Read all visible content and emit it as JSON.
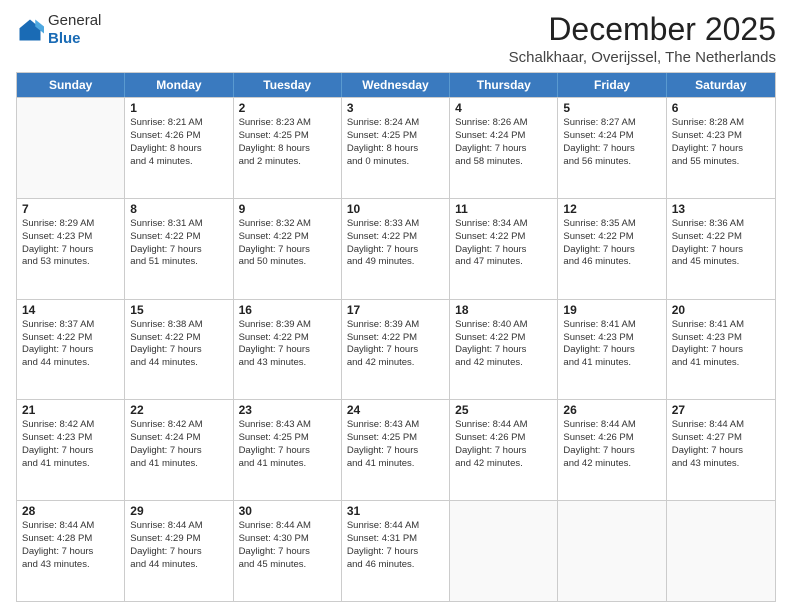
{
  "logo": {
    "general": "General",
    "blue": "Blue"
  },
  "title": "December 2025",
  "subtitle": "Schalkhaar, Overijssel, The Netherlands",
  "calendar": {
    "headers": [
      "Sunday",
      "Monday",
      "Tuesday",
      "Wednesday",
      "Thursday",
      "Friday",
      "Saturday"
    ],
    "weeks": [
      [
        {
          "date": "",
          "info": ""
        },
        {
          "date": "1",
          "info": "Sunrise: 8:21 AM\nSunset: 4:26 PM\nDaylight: 8 hours\nand 4 minutes."
        },
        {
          "date": "2",
          "info": "Sunrise: 8:23 AM\nSunset: 4:25 PM\nDaylight: 8 hours\nand 2 minutes."
        },
        {
          "date": "3",
          "info": "Sunrise: 8:24 AM\nSunset: 4:25 PM\nDaylight: 8 hours\nand 0 minutes."
        },
        {
          "date": "4",
          "info": "Sunrise: 8:26 AM\nSunset: 4:24 PM\nDaylight: 7 hours\nand 58 minutes."
        },
        {
          "date": "5",
          "info": "Sunrise: 8:27 AM\nSunset: 4:24 PM\nDaylight: 7 hours\nand 56 minutes."
        },
        {
          "date": "6",
          "info": "Sunrise: 8:28 AM\nSunset: 4:23 PM\nDaylight: 7 hours\nand 55 minutes."
        }
      ],
      [
        {
          "date": "7",
          "info": "Sunrise: 8:29 AM\nSunset: 4:23 PM\nDaylight: 7 hours\nand 53 minutes."
        },
        {
          "date": "8",
          "info": "Sunrise: 8:31 AM\nSunset: 4:22 PM\nDaylight: 7 hours\nand 51 minutes."
        },
        {
          "date": "9",
          "info": "Sunrise: 8:32 AM\nSunset: 4:22 PM\nDaylight: 7 hours\nand 50 minutes."
        },
        {
          "date": "10",
          "info": "Sunrise: 8:33 AM\nSunset: 4:22 PM\nDaylight: 7 hours\nand 49 minutes."
        },
        {
          "date": "11",
          "info": "Sunrise: 8:34 AM\nSunset: 4:22 PM\nDaylight: 7 hours\nand 47 minutes."
        },
        {
          "date": "12",
          "info": "Sunrise: 8:35 AM\nSunset: 4:22 PM\nDaylight: 7 hours\nand 46 minutes."
        },
        {
          "date": "13",
          "info": "Sunrise: 8:36 AM\nSunset: 4:22 PM\nDaylight: 7 hours\nand 45 minutes."
        }
      ],
      [
        {
          "date": "14",
          "info": "Sunrise: 8:37 AM\nSunset: 4:22 PM\nDaylight: 7 hours\nand 44 minutes."
        },
        {
          "date": "15",
          "info": "Sunrise: 8:38 AM\nSunset: 4:22 PM\nDaylight: 7 hours\nand 44 minutes."
        },
        {
          "date": "16",
          "info": "Sunrise: 8:39 AM\nSunset: 4:22 PM\nDaylight: 7 hours\nand 43 minutes."
        },
        {
          "date": "17",
          "info": "Sunrise: 8:39 AM\nSunset: 4:22 PM\nDaylight: 7 hours\nand 42 minutes."
        },
        {
          "date": "18",
          "info": "Sunrise: 8:40 AM\nSunset: 4:22 PM\nDaylight: 7 hours\nand 42 minutes."
        },
        {
          "date": "19",
          "info": "Sunrise: 8:41 AM\nSunset: 4:23 PM\nDaylight: 7 hours\nand 41 minutes."
        },
        {
          "date": "20",
          "info": "Sunrise: 8:41 AM\nSunset: 4:23 PM\nDaylight: 7 hours\nand 41 minutes."
        }
      ],
      [
        {
          "date": "21",
          "info": "Sunrise: 8:42 AM\nSunset: 4:23 PM\nDaylight: 7 hours\nand 41 minutes."
        },
        {
          "date": "22",
          "info": "Sunrise: 8:42 AM\nSunset: 4:24 PM\nDaylight: 7 hours\nand 41 minutes."
        },
        {
          "date": "23",
          "info": "Sunrise: 8:43 AM\nSunset: 4:25 PM\nDaylight: 7 hours\nand 41 minutes."
        },
        {
          "date": "24",
          "info": "Sunrise: 8:43 AM\nSunset: 4:25 PM\nDaylight: 7 hours\nand 41 minutes."
        },
        {
          "date": "25",
          "info": "Sunrise: 8:44 AM\nSunset: 4:26 PM\nDaylight: 7 hours\nand 42 minutes."
        },
        {
          "date": "26",
          "info": "Sunrise: 8:44 AM\nSunset: 4:26 PM\nDaylight: 7 hours\nand 42 minutes."
        },
        {
          "date": "27",
          "info": "Sunrise: 8:44 AM\nSunset: 4:27 PM\nDaylight: 7 hours\nand 43 minutes."
        }
      ],
      [
        {
          "date": "28",
          "info": "Sunrise: 8:44 AM\nSunset: 4:28 PM\nDaylight: 7 hours\nand 43 minutes."
        },
        {
          "date": "29",
          "info": "Sunrise: 8:44 AM\nSunset: 4:29 PM\nDaylight: 7 hours\nand 44 minutes."
        },
        {
          "date": "30",
          "info": "Sunrise: 8:44 AM\nSunset: 4:30 PM\nDaylight: 7 hours\nand 45 minutes."
        },
        {
          "date": "31",
          "info": "Sunrise: 8:44 AM\nSunset: 4:31 PM\nDaylight: 7 hours\nand 46 minutes."
        },
        {
          "date": "",
          "info": ""
        },
        {
          "date": "",
          "info": ""
        },
        {
          "date": "",
          "info": ""
        }
      ]
    ]
  }
}
